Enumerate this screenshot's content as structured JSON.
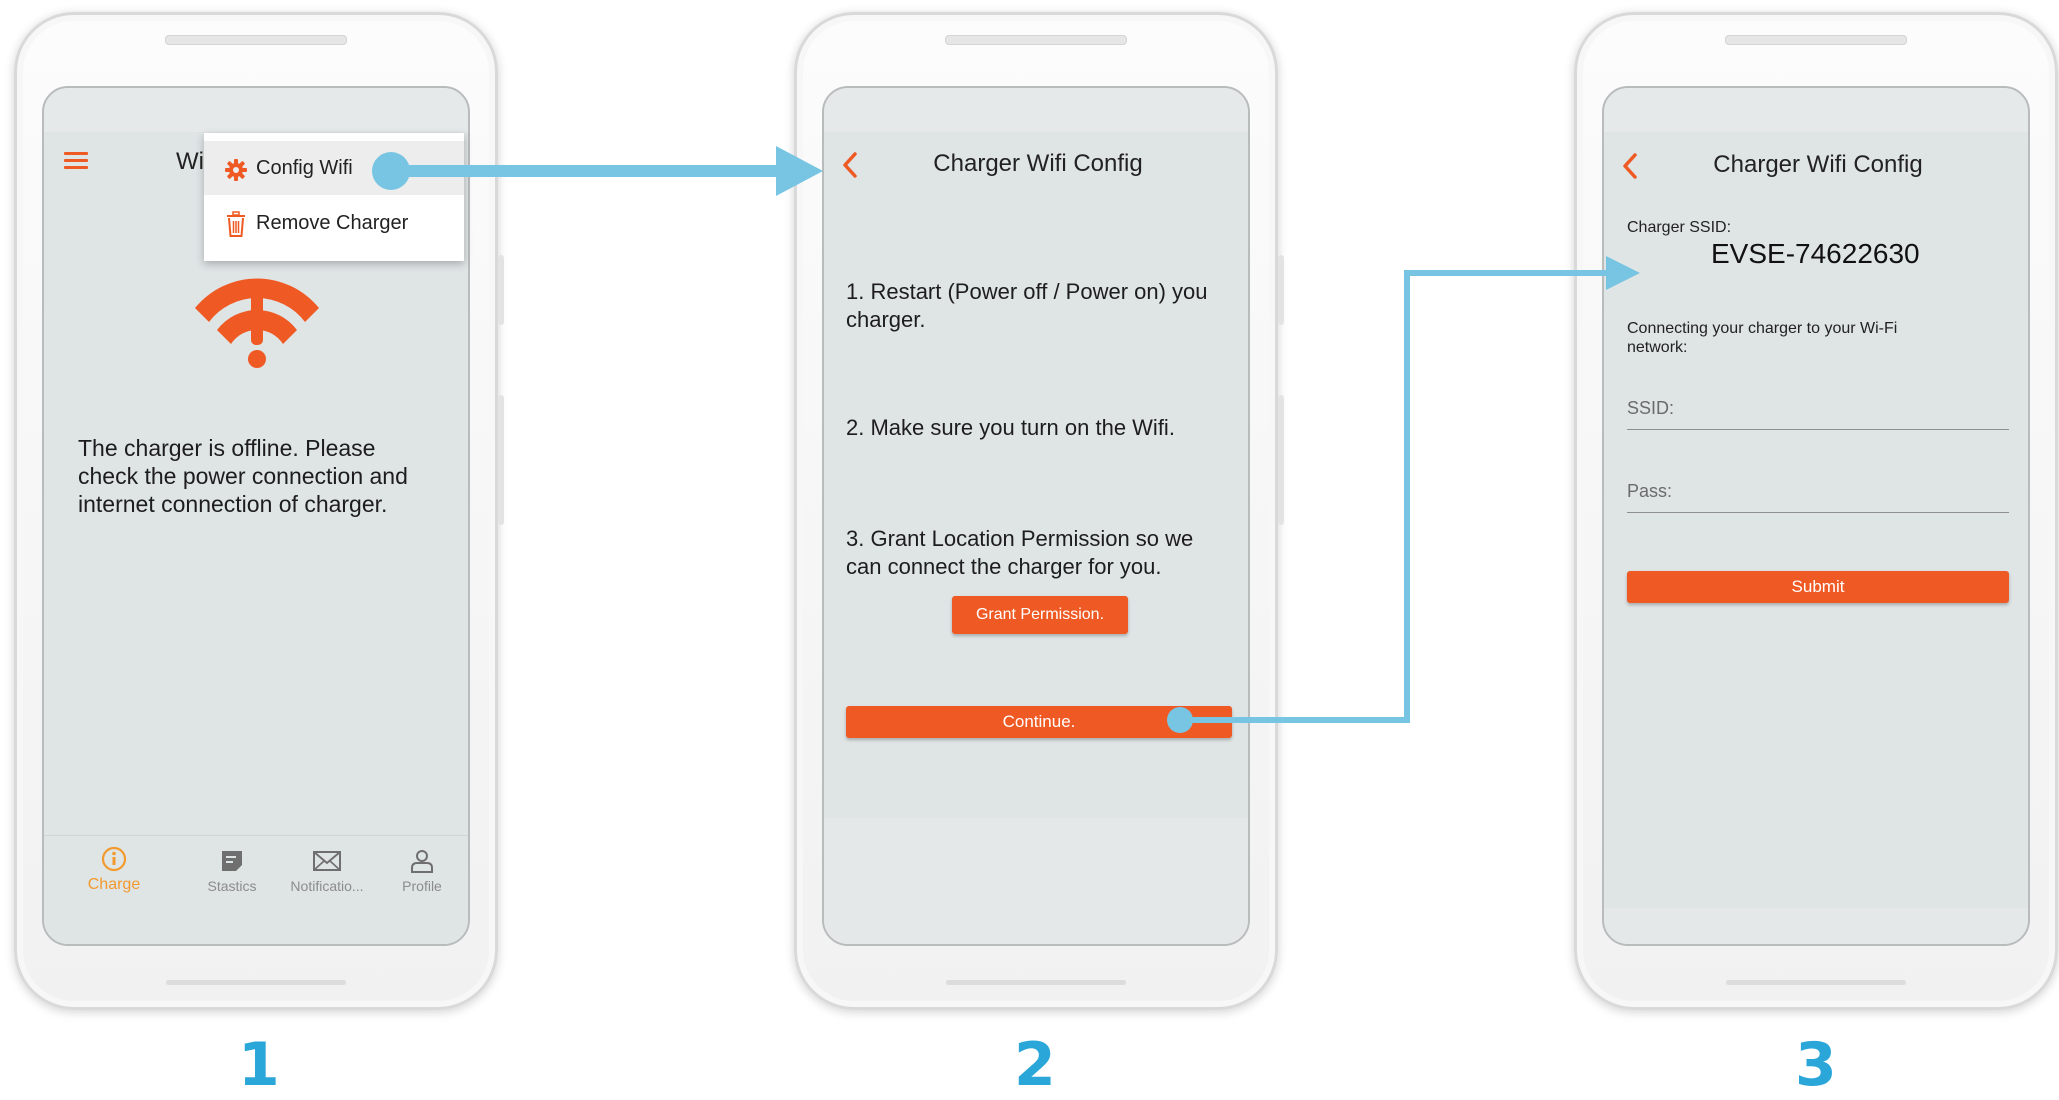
{
  "screen1": {
    "header_title_partial": "Wi",
    "menu": [
      {
        "label": "Config Wifi",
        "icon": "gear-icon"
      },
      {
        "label": "Remove Charger",
        "icon": "trash-icon"
      }
    ],
    "message": "The charger is offline. Please check the power connection and internet connection of charger.",
    "tabs": [
      {
        "label": "Charge",
        "icon": "charge-icon"
      },
      {
        "label": "Stastics",
        "icon": "stats-icon"
      },
      {
        "label": "Notificatio...",
        "icon": "mail-icon"
      },
      {
        "label": "Profile",
        "icon": "profile-icon"
      }
    ],
    "step": "1"
  },
  "screen2": {
    "title": "Charger Wifi Config",
    "instructions": [
      "1. Restart (Power off / Power on) you charger.",
      "2. Make sure you turn on the Wifi.",
      "3. Grant Location Permission so we can connect the charger for you."
    ],
    "grant_button": "Grant Permission.",
    "continue_button": "Continue.",
    "step": "2"
  },
  "screen3": {
    "title": "Charger Wifi Config",
    "ssid_label": "Charger SSID:",
    "ssid_value": "EVSE-74622630",
    "connect_text": "Connecting your charger to your Wi-Fi network:",
    "ssid_placeholder": "SSID:",
    "pass_placeholder": "Pass:",
    "submit_button": "Submit",
    "step": "3"
  },
  "colors": {
    "accent": "#ef5a24",
    "arrow": "#77c5e3",
    "step_number": "#2ba6d8",
    "screen_bg": "#dfe4e5"
  }
}
